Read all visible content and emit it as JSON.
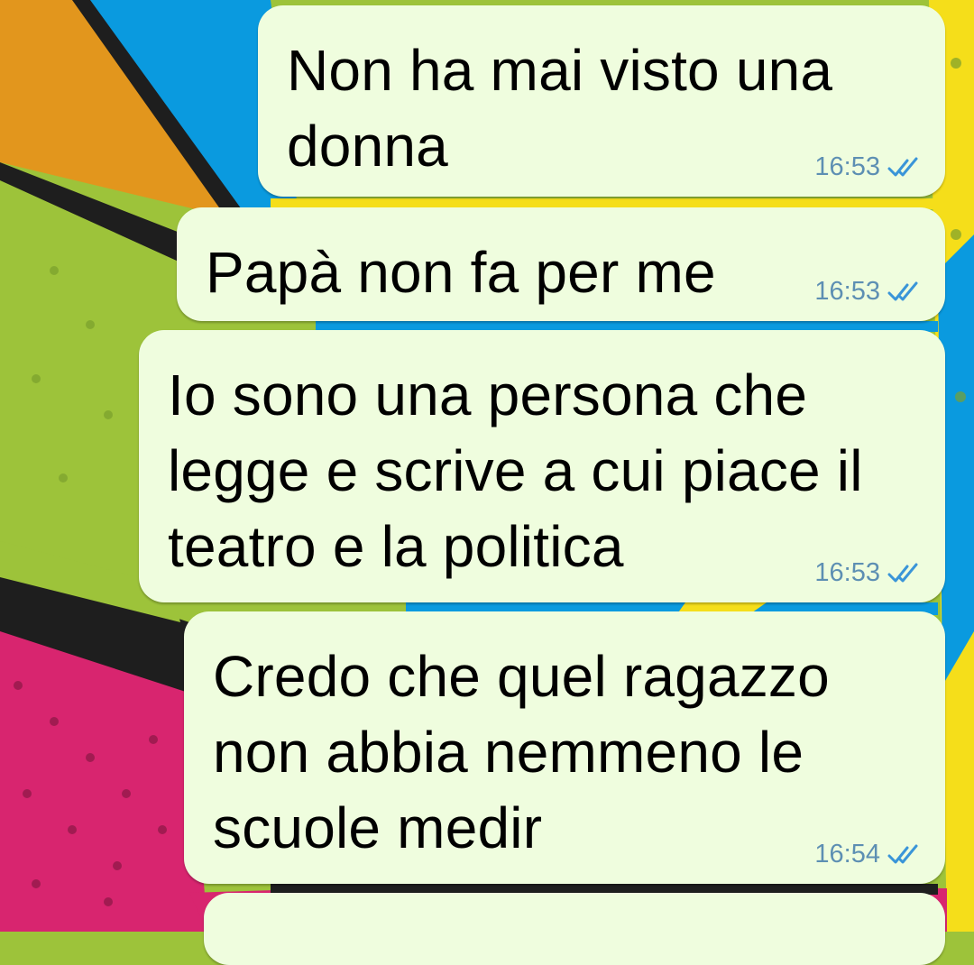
{
  "colors": {
    "bubble_out": "#effdde",
    "time": "#5d8fb3",
    "tick": "#3a95d8",
    "wallpaper": [
      "#9dc33a",
      "#0a9adf",
      "#f5de1a",
      "#e2961d",
      "#d8256f",
      "#2a2a2a"
    ]
  },
  "chat": {
    "messages": [
      {
        "text": "Non ha mai visto una donna",
        "time": "16:53",
        "status": "read-double-check-icon"
      },
      {
        "text": "Papà non fa per me",
        "time": "16:53",
        "status": "read-double-check-icon"
      },
      {
        "text": "Io sono una persona che legge e scrive a cui piace il teatro e la politica",
        "time": "16:53",
        "status": "read-double-check-icon"
      },
      {
        "text": "Credo che quel ragazzo non abbia nemmeno le scuole medir",
        "time": "16:54",
        "status": "read-double-check-icon"
      }
    ]
  }
}
